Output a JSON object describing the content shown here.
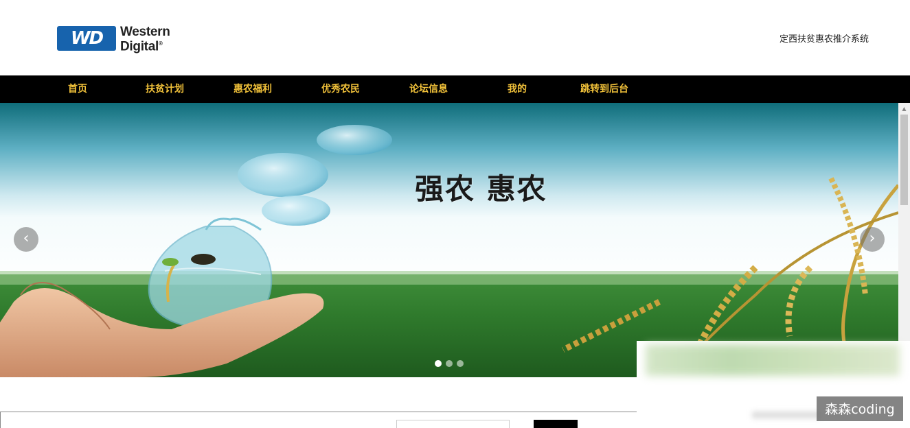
{
  "header": {
    "logo_badge": "WD",
    "logo_line1": "Western",
    "logo_line2": "Digital",
    "logo_mark": "®",
    "site_title": "定西扶贫惠农推介系统"
  },
  "nav": {
    "items": [
      "首页",
      "扶贫计划",
      "惠农福利",
      "优秀农民",
      "论坛信息",
      "我的",
      "跳转到后台"
    ]
  },
  "banner": {
    "slogan": "强农 惠农",
    "prev_icon": "chevron-left-icon",
    "next_icon": "chevron-right-icon",
    "slides": 3,
    "active_slide": 1
  },
  "watermark": {
    "text": "森森coding"
  },
  "colors": {
    "nav_bg": "#000000",
    "nav_text": "#f2c23a",
    "logo_blue": "#1763ad"
  }
}
